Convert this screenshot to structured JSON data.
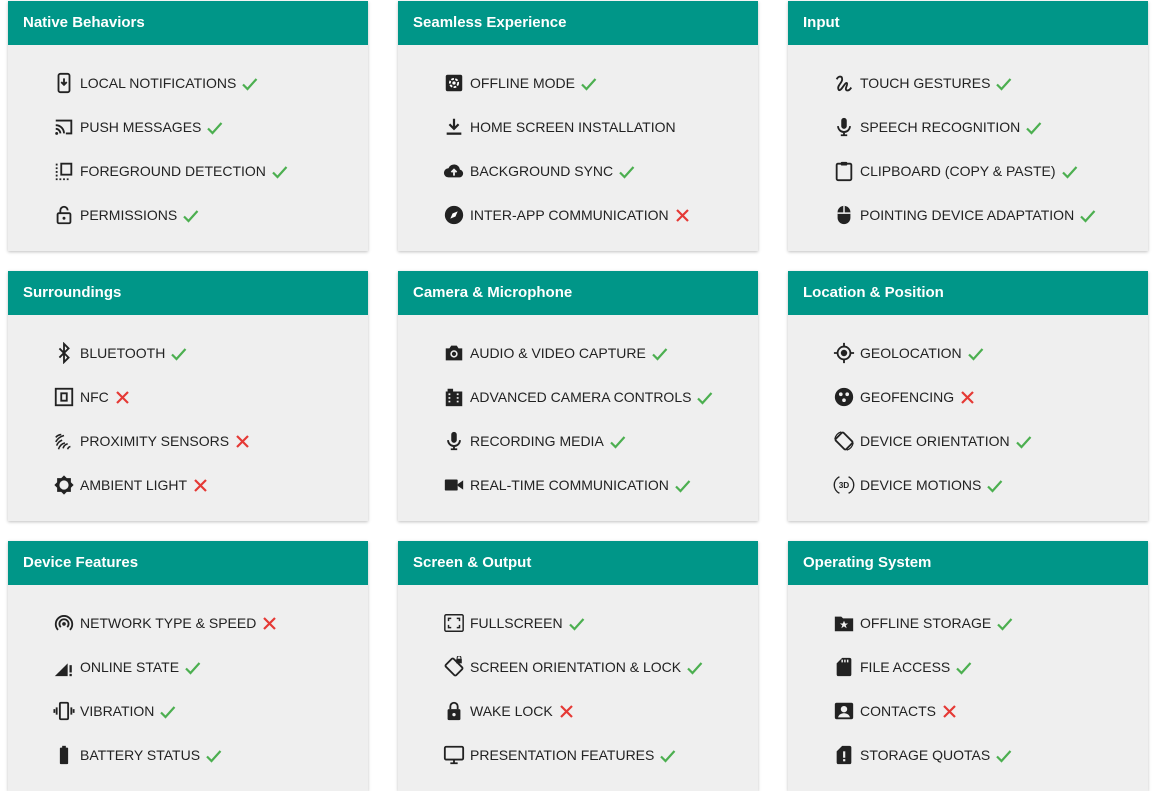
{
  "colors": {
    "header": "#009688",
    "card": "#efefef",
    "check": "#4caf50",
    "cross": "#e53935"
  },
  "cards": [
    {
      "title": "Native Behaviors",
      "items": [
        {
          "label": "LOCAL NOTIFICATIONS",
          "icon": "phone-download-icon",
          "supported": true
        },
        {
          "label": "PUSH MESSAGES",
          "icon": "cast-icon",
          "supported": true
        },
        {
          "label": "FOREGROUND DETECTION",
          "icon": "selection-icon",
          "supported": true
        },
        {
          "label": "PERMISSIONS",
          "icon": "lock-open-icon",
          "supported": true
        }
      ]
    },
    {
      "title": "Seamless Experience",
      "items": [
        {
          "label": "OFFLINE MODE",
          "icon": "gear-box-icon",
          "supported": true
        },
        {
          "label": "HOME SCREEN INSTALLATION",
          "icon": "download-icon",
          "supported": null
        },
        {
          "label": "BACKGROUND SYNC",
          "icon": "cloud-upload-icon",
          "supported": true
        },
        {
          "label": "INTER-APP COMMUNICATION",
          "icon": "compass-icon",
          "supported": false
        }
      ]
    },
    {
      "title": "Input",
      "items": [
        {
          "label": "TOUCH GESTURES",
          "icon": "gesture-icon",
          "supported": true
        },
        {
          "label": "SPEECH RECOGNITION",
          "icon": "microphone-icon",
          "supported": true
        },
        {
          "label": "CLIPBOARD (COPY & PASTE)",
          "icon": "clipboard-icon",
          "supported": true
        },
        {
          "label": "POINTING DEVICE ADAPTATION",
          "icon": "mouse-icon",
          "supported": true
        }
      ]
    },
    {
      "title": "Surroundings",
      "items": [
        {
          "label": "BLUETOOTH",
          "icon": "bluetooth-icon",
          "supported": true
        },
        {
          "label": "NFC",
          "icon": "nfc-icon",
          "supported": false
        },
        {
          "label": "PROXIMITY SENSORS",
          "icon": "proximity-icon",
          "supported": false
        },
        {
          "label": "AMBIENT LIGHT",
          "icon": "brightness-icon",
          "supported": false
        }
      ]
    },
    {
      "title": "Camera & Microphone",
      "items": [
        {
          "label": "AUDIO & VIDEO CAPTURE",
          "icon": "camera-icon",
          "supported": true
        },
        {
          "label": "ADVANCED CAMERA CONTROLS",
          "icon": "camera-roll-icon",
          "supported": true
        },
        {
          "label": "RECORDING MEDIA",
          "icon": "microphone-icon",
          "supported": true
        },
        {
          "label": "REAL-TIME COMMUNICATION",
          "icon": "videocam-icon",
          "supported": true
        }
      ]
    },
    {
      "title": "Location & Position",
      "items": [
        {
          "label": "GEOLOCATION",
          "icon": "crosshair-icon",
          "supported": true
        },
        {
          "label": "GEOFENCING",
          "icon": "dots-circle-icon",
          "supported": false
        },
        {
          "label": "DEVICE ORIENTATION",
          "icon": "screen-rotation-icon",
          "supported": true
        },
        {
          "label": "DEVICE MOTIONS",
          "icon": "rotate-3d-icon",
          "supported": true
        }
      ]
    },
    {
      "title": "Device Features",
      "items": [
        {
          "label": "NETWORK TYPE & SPEED",
          "icon": "wifi-tethering-icon",
          "supported": false
        },
        {
          "label": "ONLINE STATE",
          "icon": "signal-alert-icon",
          "supported": true
        },
        {
          "label": "VIBRATION",
          "icon": "vibration-icon",
          "supported": true
        },
        {
          "label": "BATTERY STATUS",
          "icon": "battery-icon",
          "supported": true
        }
      ]
    },
    {
      "title": "Screen & Output",
      "items": [
        {
          "label": "FULLSCREEN",
          "icon": "fullscreen-icon",
          "supported": true
        },
        {
          "label": "SCREEN ORIENTATION & LOCK",
          "icon": "screen-lock-rotation-icon",
          "supported": true
        },
        {
          "label": "WAKE LOCK",
          "icon": "lock-icon",
          "supported": false
        },
        {
          "label": "PRESENTATION FEATURES",
          "icon": "monitor-icon",
          "supported": true
        }
      ]
    },
    {
      "title": "Operating System",
      "items": [
        {
          "label": "OFFLINE STORAGE",
          "icon": "folder-star-icon",
          "supported": true
        },
        {
          "label": "FILE ACCESS",
          "icon": "sd-card-icon",
          "supported": true
        },
        {
          "label": "CONTACTS",
          "icon": "contact-icon",
          "supported": false
        },
        {
          "label": "STORAGE QUOTAS",
          "icon": "sim-alert-icon",
          "supported": true
        }
      ]
    }
  ]
}
